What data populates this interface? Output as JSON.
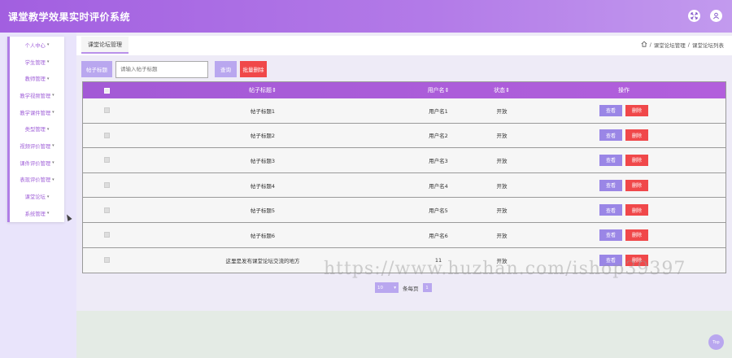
{
  "app": {
    "title": "课堂教学效果实时评价系统"
  },
  "header_icons": [
    "fullscreen-icon",
    "user-icon"
  ],
  "sidebar": {
    "items": [
      {
        "label": "个人中心",
        "has_caret": true
      },
      {
        "label": "学生管理",
        "has_caret": true
      },
      {
        "label": "教师管理",
        "has_caret": true
      },
      {
        "label": "教学视频管理",
        "has_caret": true
      },
      {
        "label": "教学课件管理",
        "has_caret": true
      },
      {
        "label": "类型管理",
        "has_caret": true
      },
      {
        "label": "视频评价管理",
        "has_caret": true
      },
      {
        "label": "课件评价管理",
        "has_caret": true
      },
      {
        "label": "表现评价管理",
        "has_caret": true
      },
      {
        "label": "课堂论坛",
        "has_caret": true
      },
      {
        "label": "系统管理",
        "has_caret": true
      }
    ]
  },
  "breadcrumb": {
    "tab": "课堂论坛管理",
    "path": [
      "课堂论坛管理",
      "课堂论坛列表"
    ],
    "separator": "/"
  },
  "search": {
    "label": "帖子标题",
    "placeholder": "请输入帖子标题",
    "query_button": "查询",
    "batch_delete_button": "批量删除"
  },
  "table": {
    "columns": [
      "帖子标题",
      "用户名",
      "状态",
      "操作"
    ],
    "sort_mark": "⇕",
    "view_label": "查看",
    "delete_label": "删除",
    "rows": [
      {
        "title": "帖子标题1",
        "user": "用户名1",
        "status": "开放"
      },
      {
        "title": "帖子标题2",
        "user": "用户名2",
        "status": "开放"
      },
      {
        "title": "帖子标题3",
        "user": "用户名3",
        "status": "开放"
      },
      {
        "title": "帖子标题4",
        "user": "用户名4",
        "status": "开放"
      },
      {
        "title": "帖子标题5",
        "user": "用户名5",
        "status": "开放"
      },
      {
        "title": "帖子标题6",
        "user": "用户名6",
        "status": "开放"
      },
      {
        "title": "这里是发布课堂论坛交流的地方",
        "user": "11",
        "status": "开放"
      }
    ]
  },
  "pagination": {
    "page_size": "10",
    "per_page_label": "条每页",
    "current_page": "1"
  },
  "watermark": "https://www.huzhan.com/ishop39397",
  "back_to_top": "Top",
  "colors": {
    "accent": "#b07de6",
    "button": "#b9a7ef",
    "danger": "#f0484a",
    "header": "#a25fe0"
  }
}
